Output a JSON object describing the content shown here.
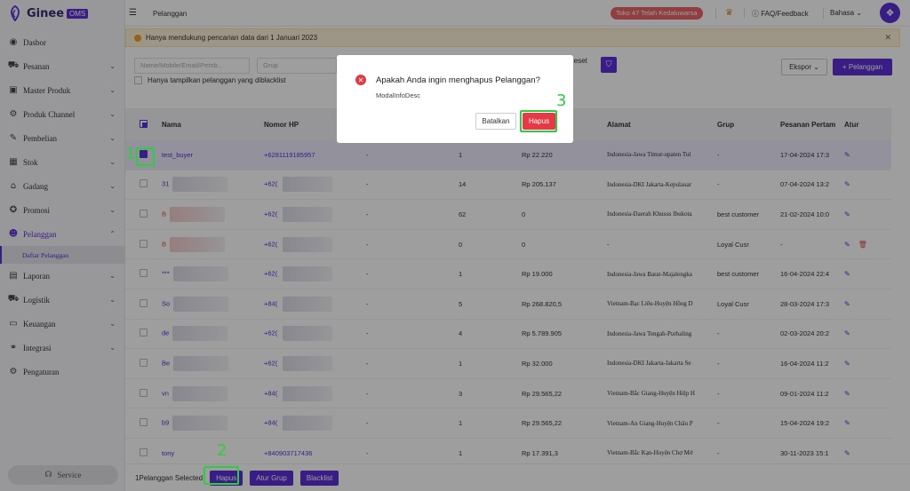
{
  "app": {
    "brand": "Ginee",
    "badge": "OMS"
  },
  "sidebar": {
    "items": [
      {
        "label": "Dasbor",
        "icon": "dashboard-icon",
        "glyph": "◉",
        "chev": ""
      },
      {
        "label": "Pesanan",
        "icon": "cart-icon",
        "glyph": "⛟",
        "chev": "⌄"
      },
      {
        "label": "Master Produk",
        "icon": "box-icon",
        "glyph": "▣",
        "chev": "⌄"
      },
      {
        "label": "Produk Channel",
        "icon": "channel-icon",
        "glyph": "⚙",
        "chev": "⌄"
      },
      {
        "label": "Pembelian",
        "icon": "purchase-icon",
        "glyph": "✎",
        "chev": "⌄"
      },
      {
        "label": "Stok",
        "icon": "stock-icon",
        "glyph": "▦",
        "chev": "⌄"
      },
      {
        "label": "Gadang",
        "icon": "warehouse-icon",
        "glyph": "⌂",
        "chev": "⌄"
      },
      {
        "label": "Promosi",
        "icon": "promo-icon",
        "glyph": "✪",
        "chev": "⌄"
      },
      {
        "label": "Pelanggan",
        "icon": "customers-icon",
        "glyph": "☻",
        "chev": "⌃"
      }
    ],
    "sub_item": "Daftar Pelanggan",
    "items_after": [
      {
        "label": "Laporan",
        "icon": "report-icon",
        "glyph": "▤",
        "chev": "⌄"
      },
      {
        "label": "Logistik",
        "icon": "logistics-icon",
        "glyph": "⛟",
        "chev": "⌄"
      },
      {
        "label": "Keuangan",
        "icon": "finance-icon",
        "glyph": "▭",
        "chev": "⌄"
      },
      {
        "label": "Integrasi",
        "icon": "integration-icon",
        "glyph": "⚭",
        "chev": "⌄"
      },
      {
        "label": "Pengaturan",
        "icon": "settings-icon",
        "glyph": "⚙",
        "chev": ""
      }
    ],
    "service": "Service"
  },
  "topbar": {
    "breadcrumb": "Pelanggan",
    "expired": "Toko 47 Telah Kedaluwarsa",
    "faq": "FAQ/Feedback",
    "language": "Bahasa"
  },
  "notice": "Hanya mendukung pencarian data dari 1 Januari 2023",
  "filters": {
    "search_placeholder": "Name/Mobile/Email/Pemb...",
    "group_placeholder": "Grup",
    "reset": "Reset",
    "export": "Ekspor",
    "add": "+ Pelanggan",
    "blacklist_only": "Hanya tampilkan pelanggan yang diblacklist"
  },
  "table": {
    "headers": [
      "Nama",
      "Nomor HP",
      "",
      "",
      "",
      "Alamat",
      "Grup",
      "Pesanan Pertam",
      "Atur"
    ],
    "rows": [
      {
        "name": "test_buyer",
        "phone": "+6281119185957",
        "email": "-",
        "orders": "1",
        "amount": "Rp 22.220",
        "address": "Indonesia-Jawa Timur-upaten Tul",
        "group": "-",
        "first": "17-04-2024 17:3",
        "selected": true,
        "red": false,
        "blur": false,
        "del": false
      },
      {
        "name": "31",
        "phone": "+62(",
        "email": "-",
        "orders": "14",
        "amount": "Rp 205.137",
        "address": "Indonesia-DKI Jakarta-Kepulauar",
        "group": "-",
        "first": "07-04-2024 13:2",
        "selected": false,
        "red": false,
        "blur": true,
        "del": false
      },
      {
        "name": "B",
        "phone": "+62(",
        "email": "-",
        "orders": "62",
        "amount": "0",
        "address": "Indonesia-Daerah Khusus Ibukota",
        "group": "best customer",
        "first": "21-02-2024 10:0",
        "selected": false,
        "red": true,
        "blur": true,
        "del": false
      },
      {
        "name": "B",
        "phone": "+62(",
        "email": "-",
        "orders": "0",
        "amount": "0",
        "address": "-",
        "group": "Loyal Cusr",
        "first": "-",
        "selected": false,
        "red": true,
        "blur": true,
        "del": true
      },
      {
        "name": "***",
        "phone": "+62(",
        "email": "-",
        "orders": "1",
        "amount": "Rp 19.000",
        "address": "Indonesia-Jawa Barat-Majalengka",
        "group": "best customer",
        "first": "16-04-2024 22:4",
        "selected": false,
        "red": false,
        "blur": true,
        "del": false
      },
      {
        "name": "So",
        "phone": "+84(",
        "email": "-",
        "orders": "5",
        "amount": "Rp 268.820,5",
        "address": "Vietnam-Bạc Liêu-Huyện Hồng D",
        "group": "Loyal Cusr",
        "first": "28-03-2024 17:3",
        "selected": false,
        "red": false,
        "blur": true,
        "del": false
      },
      {
        "name": "de",
        "phone": "+62(",
        "email": "-",
        "orders": "4",
        "amount": "Rp 5.789.905",
        "address": "Indonesia-Jawa Tengah-Purbaling",
        "group": "-",
        "first": "02-03-2024 20:2",
        "selected": false,
        "red": false,
        "blur": true,
        "del": false
      },
      {
        "name": "Be",
        "phone": "+62(",
        "email": "-",
        "orders": "1",
        "amount": "Rp 32.000",
        "address": "Indonesia-DKI Jakarta-Jakarta Se",
        "group": "-",
        "first": "16-04-2024 11:2",
        "selected": false,
        "red": false,
        "blur": true,
        "del": false
      },
      {
        "name": "vn",
        "phone": "+84(",
        "email": "-",
        "orders": "3",
        "amount": "Rp 29.565,22",
        "address": "Vietnam-Bắc Giang-Huyện Hiệp H",
        "group": "-",
        "first": "09-01-2024 11:2",
        "selected": false,
        "red": false,
        "blur": true,
        "del": false
      },
      {
        "name": "b9",
        "phone": "+84(",
        "email": "-",
        "orders": "1",
        "amount": "Rp 29.565,22",
        "address": "Vietnam-An Giang-Huyện Châu P",
        "group": "-",
        "first": "15-04-2024 19:2",
        "selected": false,
        "red": false,
        "blur": true,
        "del": false
      },
      {
        "name": "tony",
        "phone": "+840903717436",
        "email": "-",
        "orders": "1",
        "amount": "Rp 17.391,3",
        "address": "Vietnam-Bắc Kạn-Huyện Chợ Mớ",
        "group": "-",
        "first": "30-11-2023 15:1",
        "selected": false,
        "red": false,
        "blur": false,
        "del": false
      }
    ]
  },
  "bottom": {
    "selected": "1Pelanggan Selected",
    "delete": "Hapus",
    "group": "Atur Grup",
    "blacklist": "Blacklist"
  },
  "modal": {
    "title": "Apakah Anda ingin menghapus Pelanggan?",
    "desc": "ModalInfoDesc",
    "cancel": "Batalkan",
    "confirm": "Hapus"
  },
  "annotations": {
    "n1": "1",
    "n2": "2",
    "n3": "3"
  },
  "colors": {
    "accent": "#5b2fd6",
    "danger": "#e63946",
    "highlight": "#2ecc40"
  }
}
